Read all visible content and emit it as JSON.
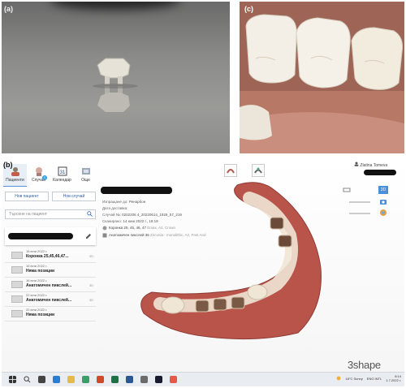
{
  "labels": {
    "a": "(a)",
    "b": "(b)",
    "c": "(c)"
  },
  "app": {
    "nav": [
      {
        "label": "Пациенти",
        "icon": "patient-icon",
        "active": true
      },
      {
        "label": "Случаи",
        "icon": "case-icon",
        "badge": "1"
      },
      {
        "label": "Календар",
        "icon": "calendar-icon",
        "num": "31"
      },
      {
        "label": "Още",
        "icon": "more-icon"
      }
    ],
    "buttons": {
      "new_patient": "Нов пациент",
      "new_case": "Нов случай"
    },
    "search_placeholder": "Търсене на пациент",
    "cases": [
      {
        "date": "18 юни 2022 г.",
        "title": "Коронка 25,45,46,47...",
        "tag": "3D"
      },
      {
        "date": "16 юни 2022 г.",
        "title": "Няма позиции",
        "tag": ""
      },
      {
        "date": "16 юни 2022 г.",
        "title": "Анатомичен пикслей...",
        "tag": "3D"
      },
      {
        "date": "22 юни 2022 г.",
        "title": "Анатомичен пикслей...",
        "tag": "3D"
      },
      {
        "date": "22 юни 2022 г.",
        "title": "Няма позиции",
        "tag": ""
      }
    ],
    "case_info": {
      "send_to_label": "Изпращане до:",
      "send_to_value": "Ренарбон",
      "delivery_label": "Дата доставка:",
      "delivery_value": "",
      "case_no_label": "Случай №:",
      "case_no_value": "0202206 4_20220614_1926_57_219",
      "scanned_label": "Сканирано:",
      "scanned_value": "14 юни 2022 г., 18:19",
      "items": [
        {
          "text": "Коронка 25, 45, 46, 47",
          "detail": "Emax, A2, Crown"
        },
        {
          "text": "Анатомичен пикслей 36",
          "detail": "Zirconia - monolithic, A2, Post And"
        }
      ]
    },
    "user_name": "Zlatina Tomeva",
    "view_3d": "3D",
    "brand": "3shape",
    "taskbar": {
      "weather": "18°C Sunny",
      "lang": "ENG INTL",
      "time": "8:14",
      "date": "1.7.2022 г."
    }
  }
}
